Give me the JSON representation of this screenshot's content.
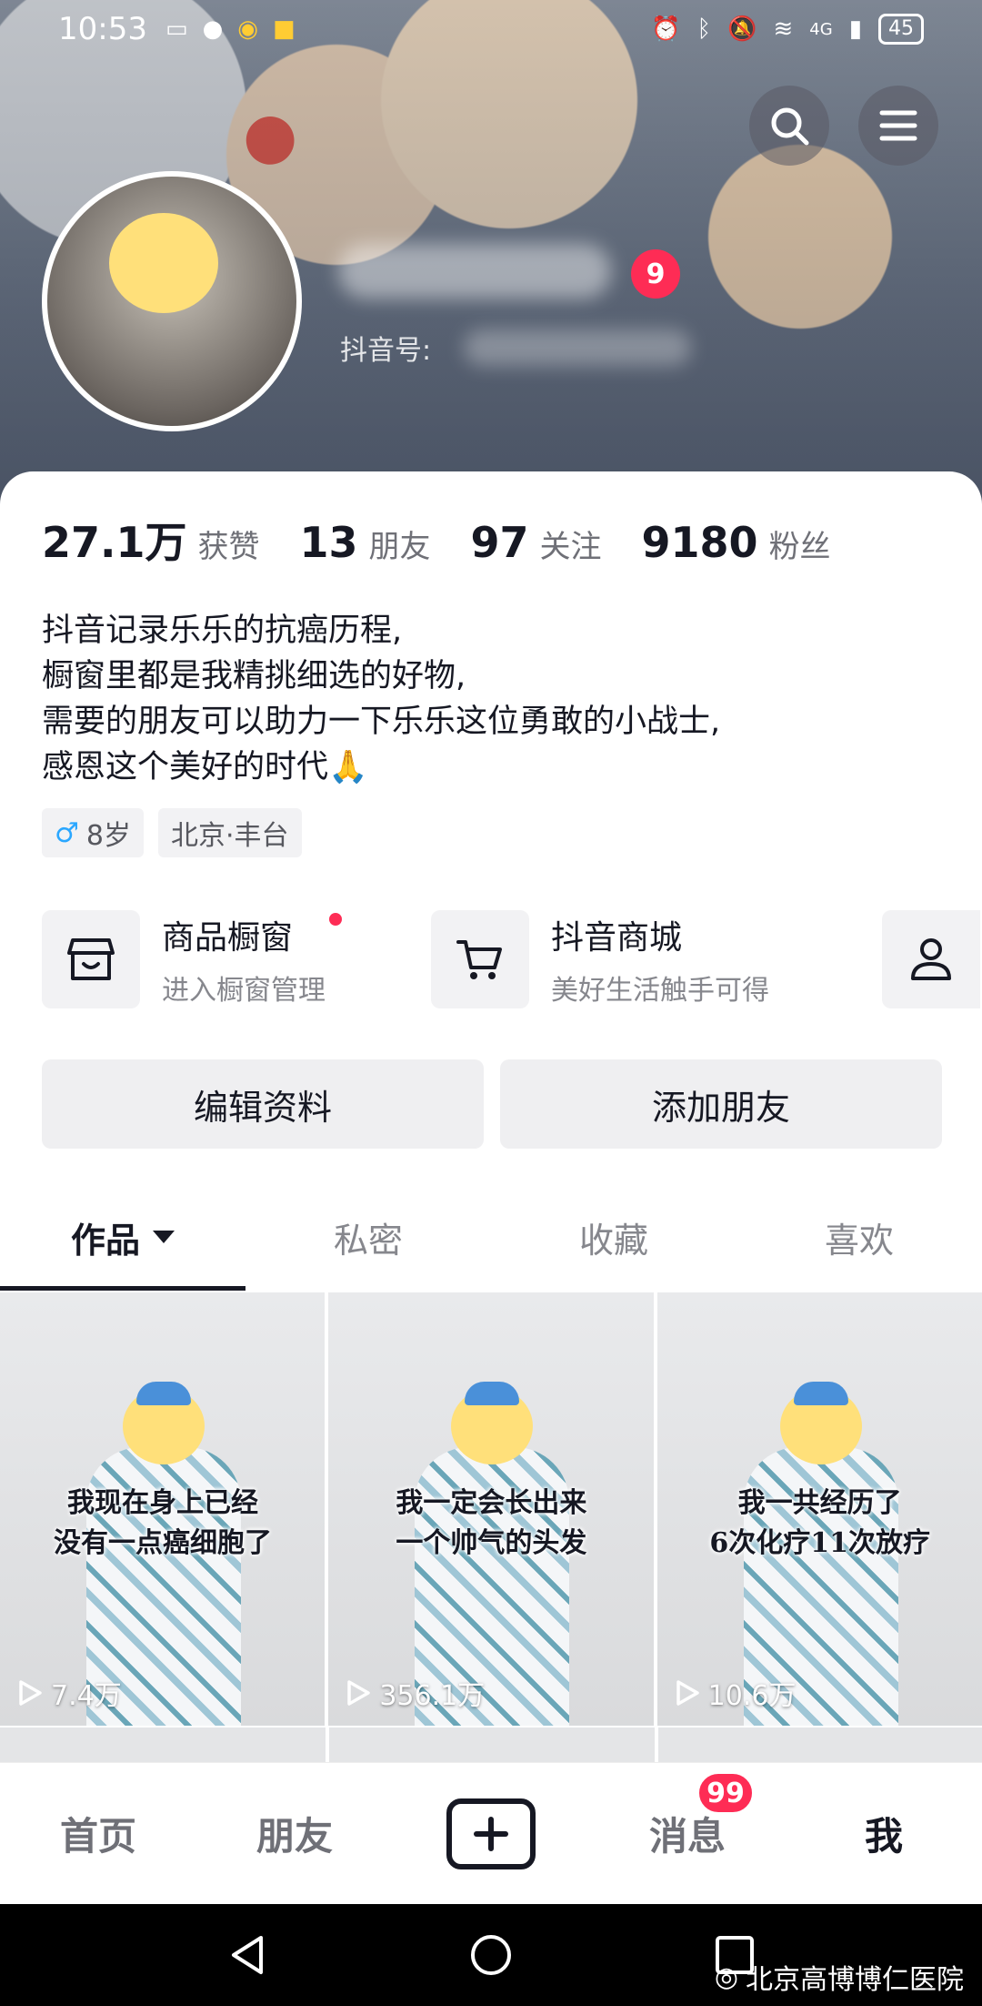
{
  "status_bar": {
    "time": "10:53",
    "left_icons": [
      "notification-icon",
      "wechat-icon",
      "weibo-icon",
      "app-icon"
    ],
    "network": "4G",
    "battery": "45"
  },
  "profile": {
    "notification_count": "9",
    "douyin_id_label": "抖音号:"
  },
  "stats": [
    {
      "value": "27.1万",
      "label": "获赞"
    },
    {
      "value": "13",
      "label": "朋友"
    },
    {
      "value": "97",
      "label": "关注"
    },
    {
      "value": "9180",
      "label": "粉丝"
    }
  ],
  "bio": [
    "抖音记录乐乐的抗癌历程,",
    "橱窗里都是我精挑细选的好物,",
    "需要的朋友可以助力一下乐乐这位勇敢的小战士,",
    "感恩这个美好的时代🙏"
  ],
  "tags": {
    "gender_symbol": "♂",
    "age": "8岁",
    "location": "北京·丰台"
  },
  "features": [
    {
      "title": "商品橱窗",
      "subtitle": "进入橱窗管理",
      "icon": "shop-icon"
    },
    {
      "title": "抖音商城",
      "subtitle": "美好生活触手可得",
      "icon": "cart-icon"
    }
  ],
  "buttons": {
    "edit_profile": "编辑资料",
    "add_friend": "添加朋友"
  },
  "tabs": [
    "作品",
    "私密",
    "收藏",
    "喜欢"
  ],
  "videos": [
    {
      "caption_line1": "我现在身上已经",
      "caption_line2": "没有一点癌细胞了",
      "plays": "7.4万"
    },
    {
      "caption_line1": "我一定会长出来",
      "caption_line2": "一个帅气的头发",
      "plays": "356.1万"
    },
    {
      "caption_line1": "我一共经历了",
      "caption_line2": "6次化疗11次放疗",
      "plays": "10.6万"
    }
  ],
  "bottom_nav": {
    "home": "首页",
    "friends": "朋友",
    "messages": "消息",
    "messages_badge": "99",
    "me": "我"
  },
  "watermark": "北京高博博仁医院",
  "colors": {
    "accent_red": "#fe2c55",
    "text_primary": "#161823",
    "text_secondary": "#86878d"
  }
}
